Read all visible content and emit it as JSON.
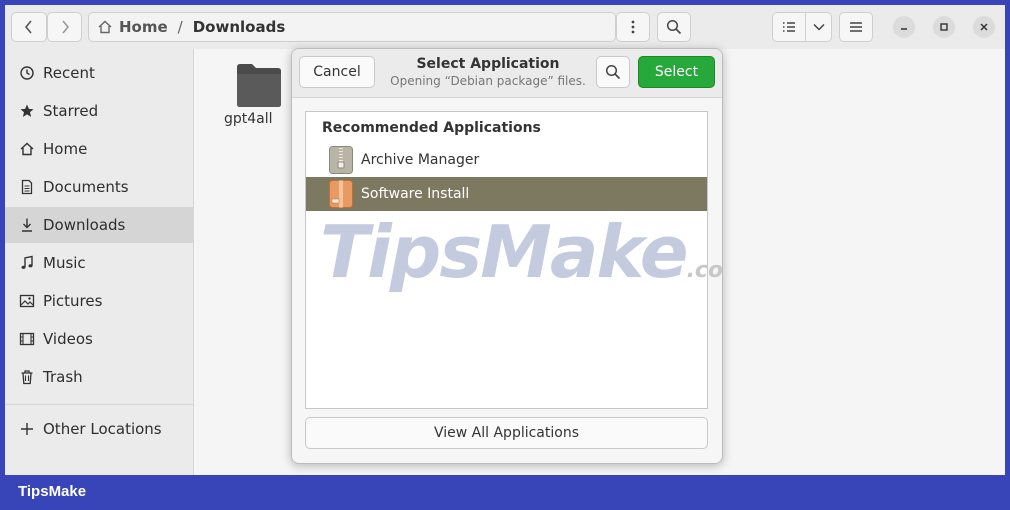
{
  "headerbar": {
    "path": {
      "home": "Home",
      "separator": "/",
      "current": "Downloads"
    }
  },
  "sidebar": {
    "items": [
      {
        "label": "Recent",
        "icon": "clock-icon"
      },
      {
        "label": "Starred",
        "icon": "star-icon"
      },
      {
        "label": "Home",
        "icon": "home-icon"
      },
      {
        "label": "Documents",
        "icon": "document-icon"
      },
      {
        "label": "Downloads",
        "icon": "download-icon",
        "selected": true
      },
      {
        "label": "Music",
        "icon": "music-icon"
      },
      {
        "label": "Pictures",
        "icon": "picture-icon"
      },
      {
        "label": "Videos",
        "icon": "video-icon"
      },
      {
        "label": "Trash",
        "icon": "trash-icon"
      }
    ],
    "other_locations": "Other Locations"
  },
  "content": {
    "files": [
      {
        "name": "gpt4all",
        "type": "folder"
      }
    ]
  },
  "dialog": {
    "cancel_label": "Cancel",
    "title": "Select Application",
    "subtitle": "Opening “Debian package” files.",
    "select_label": "Select",
    "list_heading": "Recommended Applications",
    "apps": [
      {
        "name": "Archive Manager",
        "icon": "archive-icon",
        "selected": false
      },
      {
        "name": "Software Install",
        "icon": "package-install-icon",
        "selected": true
      }
    ],
    "view_all_label": "View All Applications"
  },
  "watermark": {
    "text": "TipsMake",
    "suffix": ".com"
  },
  "brand": "TipsMake",
  "colors": {
    "accent_green": "#26a83a",
    "selection": "#7d7960",
    "frame": "#3845b8"
  }
}
